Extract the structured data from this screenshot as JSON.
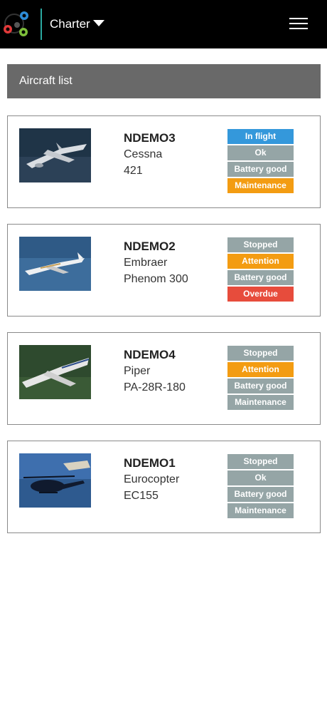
{
  "header": {
    "title": "Charter",
    "logo_icon": "spinner-logo-icon",
    "menu_icon": "hamburger-menu-icon"
  },
  "section": {
    "title": "Aircraft list"
  },
  "aircraft": [
    {
      "registration": "NDEMO3",
      "make": "Cessna",
      "model": "421",
      "image_icon": "twin-prop-plane-photo",
      "statuses": [
        {
          "label": "In flight",
          "color": "#3498db"
        },
        {
          "label": "Ok",
          "color": "#95a5a6"
        },
        {
          "label": "Battery good",
          "color": "#95a5a6"
        },
        {
          "label": "Maintenance",
          "color": "#f39c12"
        }
      ]
    },
    {
      "registration": "NDEMO2",
      "make": "Embraer",
      "model": "Phenom 300",
      "image_icon": "business-jet-photo",
      "statuses": [
        {
          "label": "Stopped",
          "color": "#95a5a6"
        },
        {
          "label": "Attention",
          "color": "#f39c12"
        },
        {
          "label": "Battery good",
          "color": "#95a5a6"
        },
        {
          "label": "Overdue",
          "color": "#e74c3c"
        }
      ]
    },
    {
      "registration": "NDEMO4",
      "make": "Piper",
      "model": "PA-28R-180",
      "image_icon": "single-prop-plane-photo",
      "statuses": [
        {
          "label": "Stopped",
          "color": "#95a5a6"
        },
        {
          "label": "Attention",
          "color": "#f39c12"
        },
        {
          "label": "Battery good",
          "color": "#95a5a6"
        },
        {
          "label": "Maintenance",
          "color": "#95a5a6"
        }
      ]
    },
    {
      "registration": "NDEMO1",
      "make": "Eurocopter",
      "model": "EC155",
      "image_icon": "helicopter-photo",
      "statuses": [
        {
          "label": "Stopped",
          "color": "#95a5a6"
        },
        {
          "label": "Ok",
          "color": "#95a5a6"
        },
        {
          "label": "Battery good",
          "color": "#95a5a6"
        },
        {
          "label": "Maintenance",
          "color": "#95a5a6"
        }
      ]
    }
  ]
}
